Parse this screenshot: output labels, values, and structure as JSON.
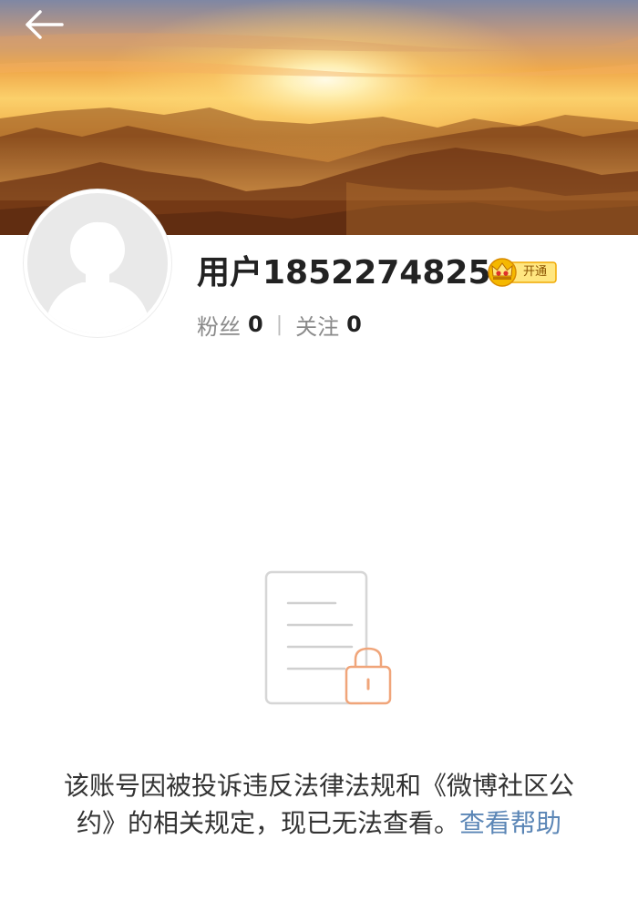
{
  "header": {
    "back_icon": "back-arrow-icon"
  },
  "profile": {
    "username": "用户1852274825",
    "vip_badge": {
      "icon": "crown-icon",
      "label": "开通",
      "accent_color": "#f5b800"
    },
    "stats": {
      "followers_label": "粉丝",
      "followers_value": "0",
      "separator": "|",
      "following_label": "关注",
      "following_value": "0"
    },
    "avatar_icon": "default-avatar-icon"
  },
  "notice": {
    "illustration_icon": "locked-document-icon",
    "message": "该账号因被投诉违反法律法规和《微博社区公约》的相关规定，现已无法查看。",
    "help_link": "查看帮助",
    "link_color": "#5b86b6"
  }
}
